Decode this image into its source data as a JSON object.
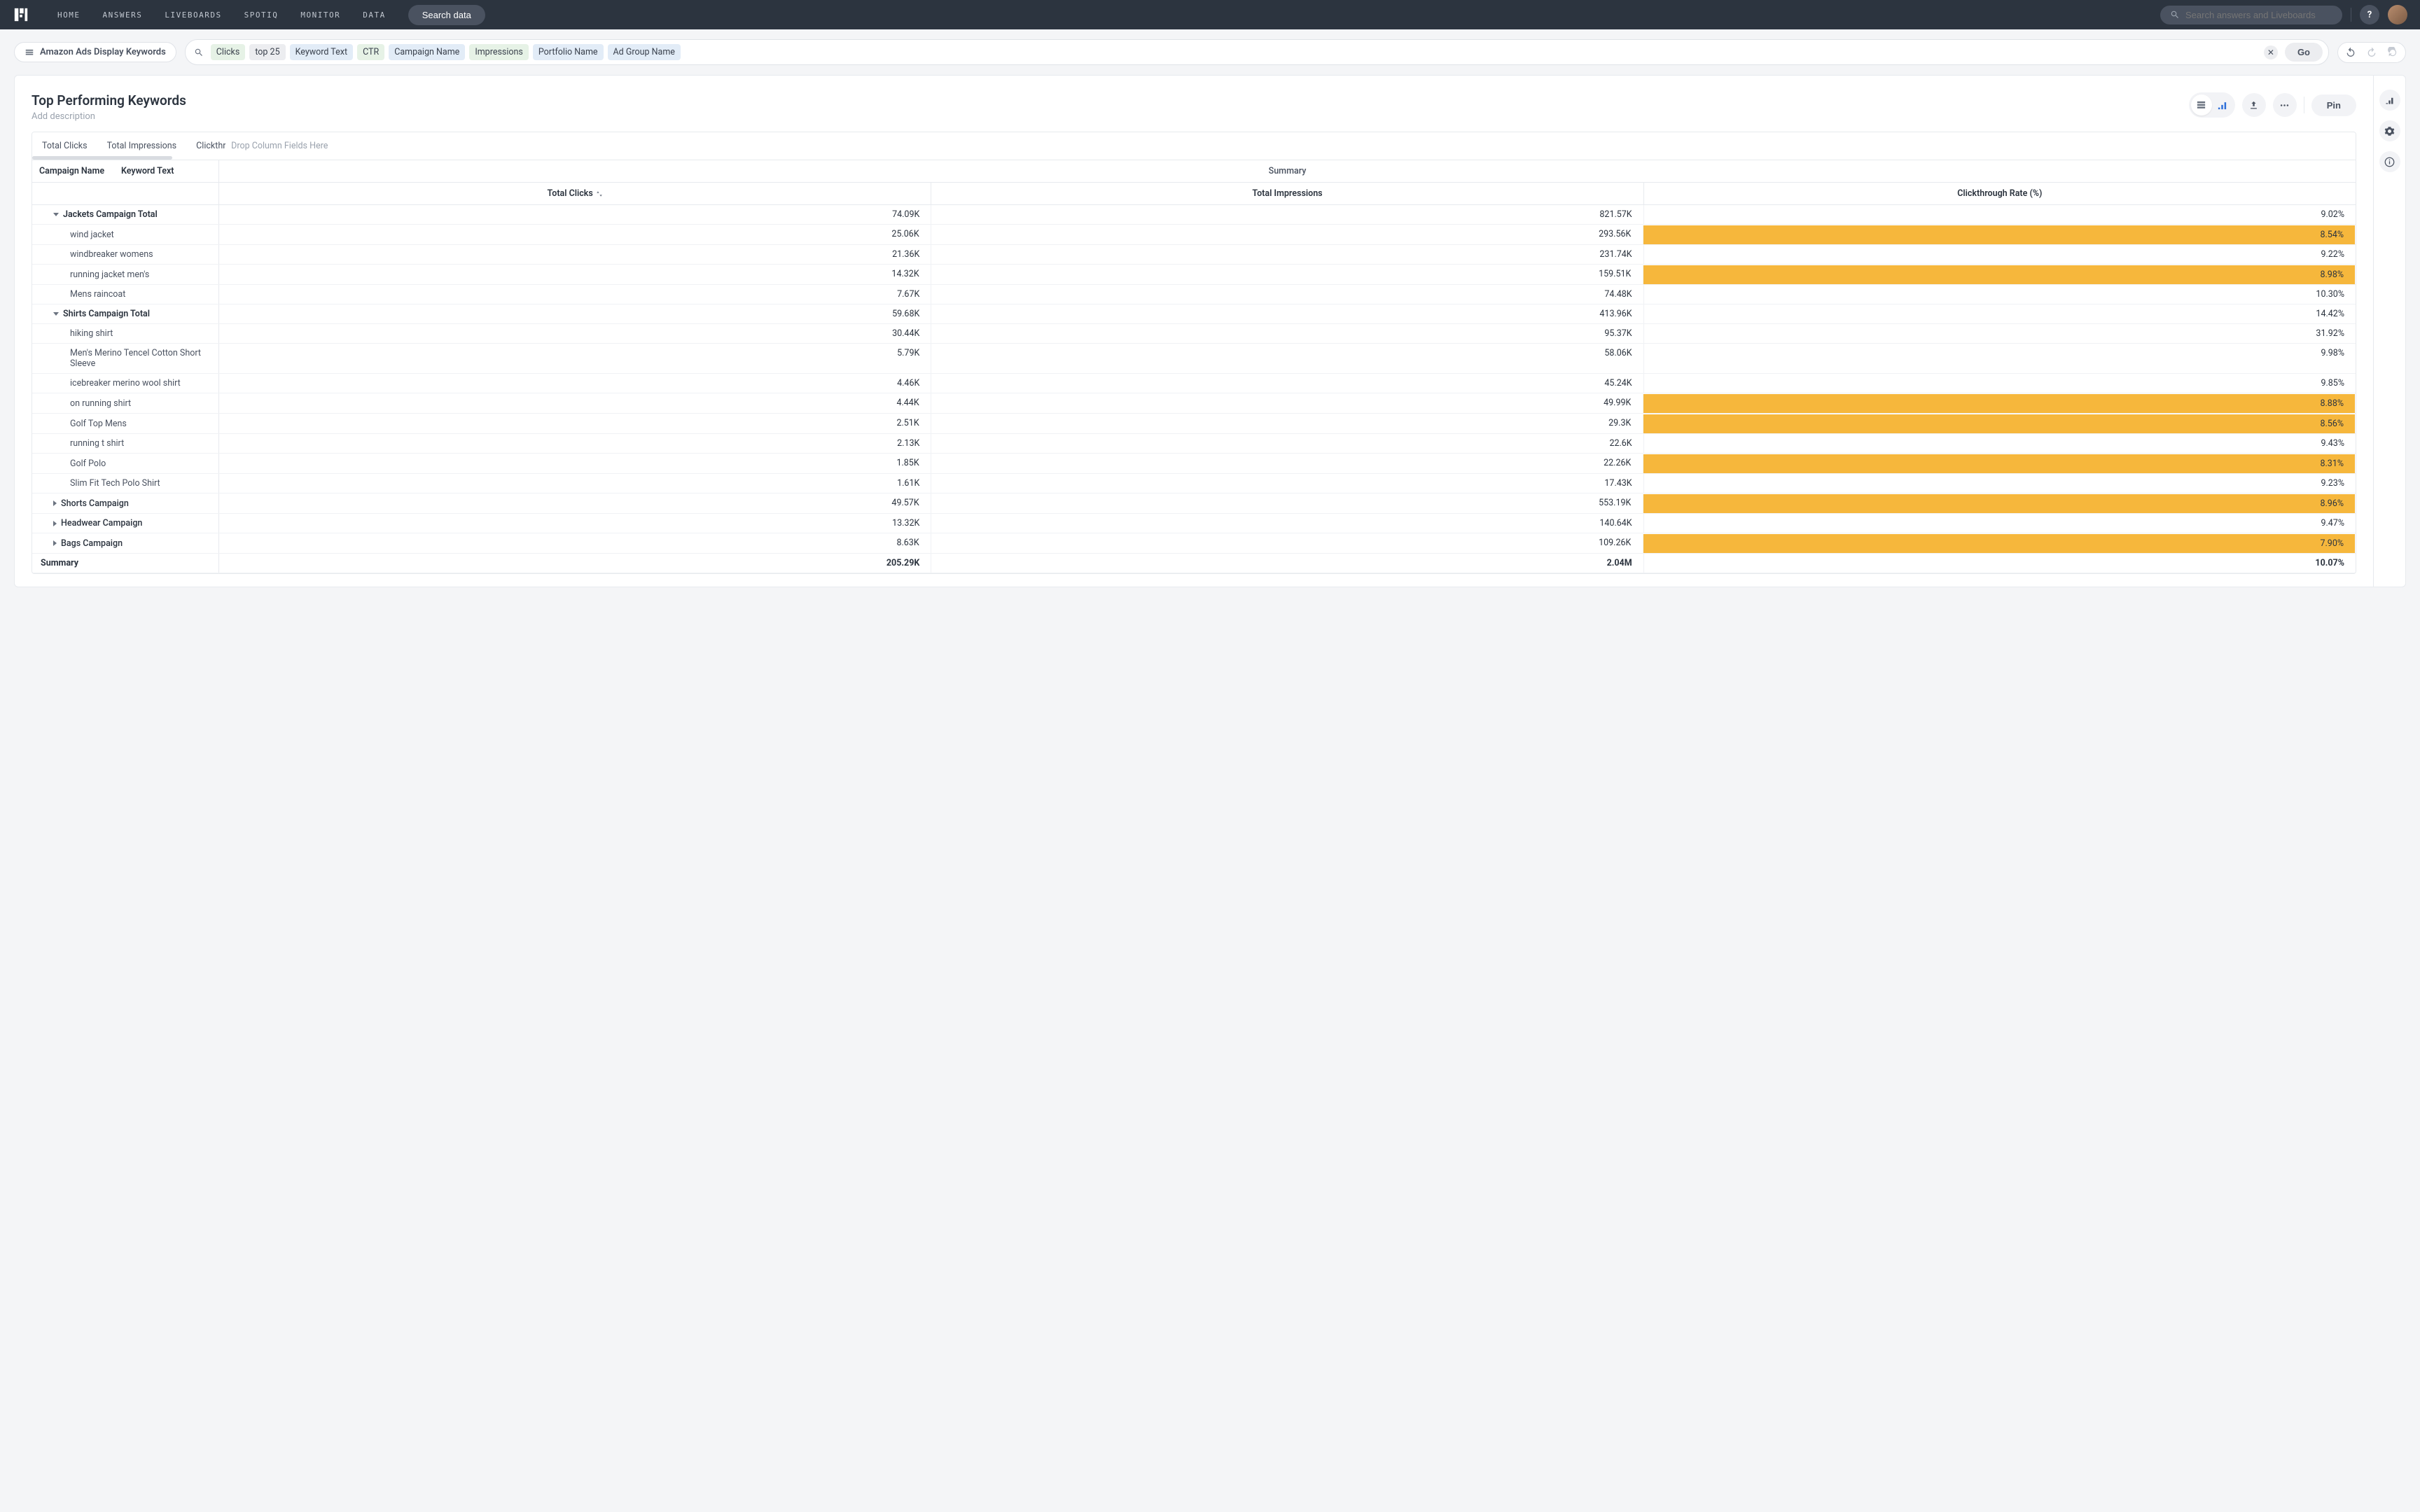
{
  "nav": {
    "links": [
      "HOME",
      "ANSWERS",
      "LIVEBOARDS",
      "SPOTIQ",
      "MONITOR",
      "DATA"
    ],
    "searchDataBtn": "Search data",
    "searchPlaceholder": "Search answers and Liveboards",
    "help": "?"
  },
  "source": {
    "label": "Amazon Ads Display Keywords"
  },
  "query": {
    "tokens": [
      {
        "text": "Clicks",
        "cls": "tok-s"
      },
      {
        "text": "top 25",
        "cls": "tok-f"
      },
      {
        "text": "Keyword Text",
        "cls": "tok-b"
      },
      {
        "text": "CTR",
        "cls": "tok-s"
      },
      {
        "text": "Campaign Name",
        "cls": "tok-b"
      },
      {
        "text": "Impressions",
        "cls": "tok-s"
      },
      {
        "text": "Portfolio Name",
        "cls": "tok-b"
      },
      {
        "text": "Ad Group Name",
        "cls": "tok-b"
      }
    ],
    "go": "Go"
  },
  "answer": {
    "title": "Top Performing Keywords",
    "subtitle": "Add description",
    "pin": "Pin"
  },
  "table": {
    "measureTabs": [
      "Total Clicks",
      "Total Impressions",
      "Clickthrough Rate (%)"
    ],
    "dropHint": "Drop Column Fields Here",
    "dimHeaders": [
      "Campaign Name",
      "Keyword Text"
    ],
    "summaryHeader": "Summary",
    "cols": [
      "Total Clicks",
      "Total Impressions",
      "Clickthrough Rate (%)"
    ],
    "rows": [
      {
        "type": "group",
        "open": true,
        "label": "Jackets Campaign Total",
        "v": [
          "74.09K",
          "821.57K",
          "9.02%"
        ],
        "hl": [
          false,
          false,
          false
        ]
      },
      {
        "type": "sub",
        "label": "wind jacket",
        "v": [
          "25.06K",
          "293.56K",
          "8.54%"
        ],
        "hl": [
          false,
          false,
          true
        ]
      },
      {
        "type": "sub",
        "label": "windbreaker womens",
        "v": [
          "21.36K",
          "231.74K",
          "9.22%"
        ],
        "hl": [
          false,
          false,
          false
        ]
      },
      {
        "type": "sub",
        "label": "running jacket men's",
        "v": [
          "14.32K",
          "159.51K",
          "8.98%"
        ],
        "hl": [
          false,
          false,
          true
        ]
      },
      {
        "type": "sub",
        "label": "Mens raincoat",
        "v": [
          "7.67K",
          "74.48K",
          "10.30%"
        ],
        "hl": [
          false,
          false,
          false
        ]
      },
      {
        "type": "group",
        "open": true,
        "label": "Shirts Campaign Total",
        "v": [
          "59.68K",
          "413.96K",
          "14.42%"
        ],
        "hl": [
          false,
          false,
          false
        ]
      },
      {
        "type": "sub",
        "label": "hiking shirt",
        "v": [
          "30.44K",
          "95.37K",
          "31.92%"
        ],
        "hl": [
          false,
          false,
          false
        ]
      },
      {
        "type": "sub",
        "label": "Men's Merino Tencel Cotton Short Sleeve",
        "v": [
          "5.79K",
          "58.06K",
          "9.98%"
        ],
        "hl": [
          false,
          false,
          false
        ]
      },
      {
        "type": "sub",
        "label": "icebreaker merino wool shirt",
        "v": [
          "4.46K",
          "45.24K",
          "9.85%"
        ],
        "hl": [
          false,
          false,
          false
        ]
      },
      {
        "type": "sub",
        "label": "on running shirt",
        "v": [
          "4.44K",
          "49.99K",
          "8.88%"
        ],
        "hl": [
          false,
          false,
          true
        ]
      },
      {
        "type": "sub",
        "label": "Golf Top Mens",
        "v": [
          "2.51K",
          "29.3K",
          "8.56%"
        ],
        "hl": [
          false,
          false,
          true
        ]
      },
      {
        "type": "sub",
        "label": "running t shirt",
        "v": [
          "2.13K",
          "22.6K",
          "9.43%"
        ],
        "hl": [
          false,
          false,
          false
        ]
      },
      {
        "type": "sub",
        "label": "Golf Polo",
        "v": [
          "1.85K",
          "22.26K",
          "8.31%"
        ],
        "hl": [
          false,
          false,
          true
        ]
      },
      {
        "type": "sub",
        "label": "Slim Fit Tech Polo Shirt",
        "v": [
          "1.61K",
          "17.43K",
          "9.23%"
        ],
        "hl": [
          false,
          false,
          false
        ]
      },
      {
        "type": "group",
        "open": false,
        "label": "Shorts Campaign",
        "v": [
          "49.57K",
          "553.19K",
          "8.96%"
        ],
        "hl": [
          false,
          false,
          true
        ]
      },
      {
        "type": "group",
        "open": false,
        "label": "Headwear Campaign",
        "v": [
          "13.32K",
          "140.64K",
          "9.47%"
        ],
        "hl": [
          false,
          false,
          false
        ]
      },
      {
        "type": "group",
        "open": false,
        "label": "Bags Campaign",
        "v": [
          "8.63K",
          "109.26K",
          "7.90%"
        ],
        "hl": [
          false,
          false,
          true
        ]
      }
    ],
    "summaryRow": {
      "label": "Summary",
      "v": [
        "205.29K",
        "2.04M",
        "10.07%"
      ]
    }
  }
}
